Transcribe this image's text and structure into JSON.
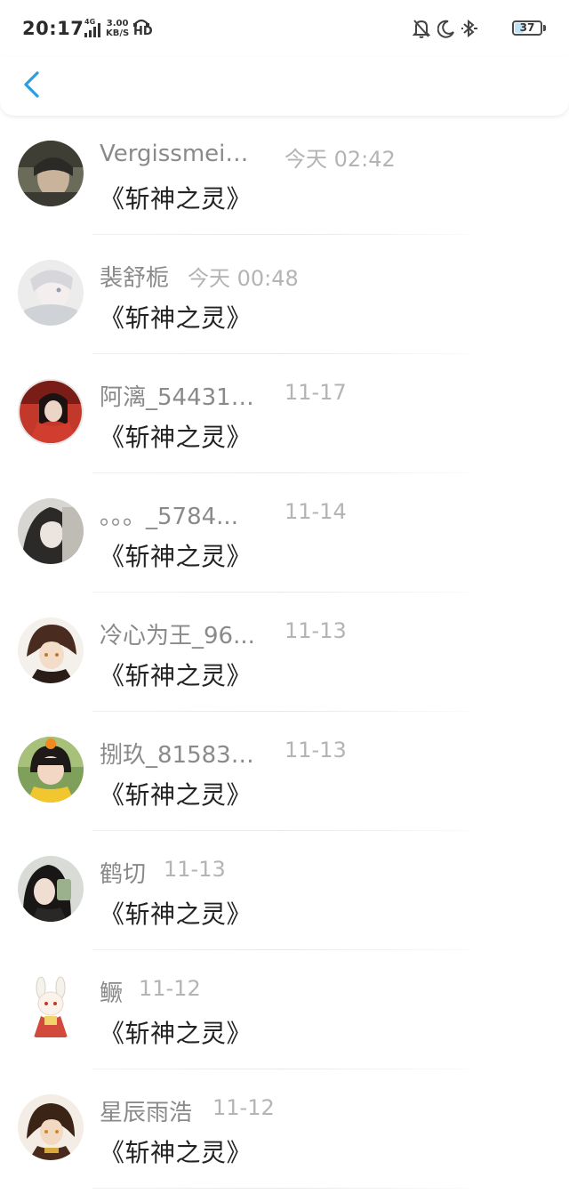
{
  "status_bar": {
    "time": "20:17",
    "network": "4G",
    "speed_value": "3.00",
    "speed_unit": "KB/S",
    "hd": "HD",
    "battery": "37",
    "battery_level": 0.37
  },
  "header": {
    "back_icon": "chevron-left-icon",
    "accent_color": "#2a9ee0"
  },
  "items": [
    {
      "name": "Vergissmein...",
      "date": "今天 02:42",
      "title": "《斩神之灵》"
    },
    {
      "name": "裴舒栀",
      "date": "今天 00:48",
      "title": "《斩神之灵》"
    },
    {
      "name": "阿漓_544312...",
      "date": "11-17",
      "title": "《斩神之灵》"
    },
    {
      "name": "。。。_5784...",
      "date": "11-14",
      "title": "《斩神之灵》"
    },
    {
      "name": "冷心为王_96...",
      "date": "11-13",
      "title": "《斩神之灵》"
    },
    {
      "name": "捌玖_815830...",
      "date": "11-13",
      "title": "《斩神之灵》"
    },
    {
      "name": "鹤切",
      "date": "11-13",
      "title": "《斩神之灵》"
    },
    {
      "name": "鳜",
      "date": "11-12",
      "title": "《斩神之灵》"
    },
    {
      "name": "星辰雨浩",
      "date": "11-12",
      "title": "《斩神之灵》"
    }
  ]
}
